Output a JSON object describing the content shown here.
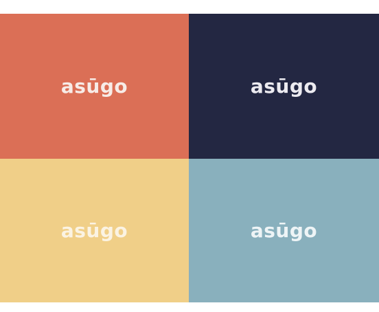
{
  "tiles": [
    {
      "label": "asūgo",
      "background": "#db6f56",
      "text_color": "#f7ece7"
    },
    {
      "label": "asūgo",
      "background": "#232742",
      "text_color": "#ecebf0"
    },
    {
      "label": "asūgo",
      "background": "#f0cf88",
      "text_color": "#fbf3e3"
    },
    {
      "label": "asūgo",
      "background": "#89b0bd",
      "text_color": "#eef4f6"
    }
  ]
}
